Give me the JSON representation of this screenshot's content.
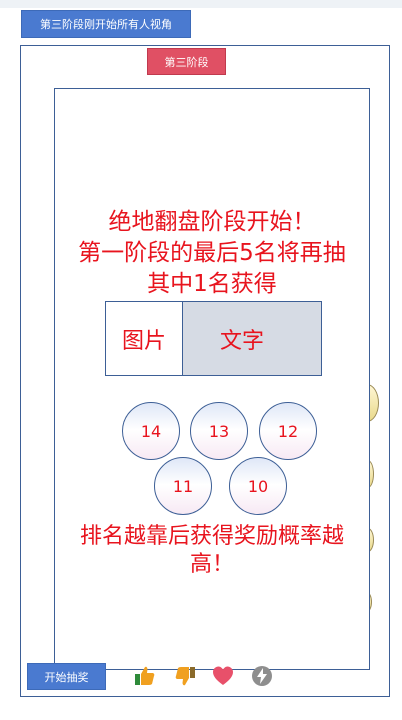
{
  "top_tab": {
    "label": "第三阶段刚开始所有人视角"
  },
  "stage_badge": {
    "label": "第三阶段"
  },
  "modal": {
    "headline": [
      "绝地翻盘阶段开始！",
      "第一阶段的最后5名将再抽",
      "其中1名获得"
    ],
    "media": {
      "image_label": "图片",
      "text_label": "文字"
    },
    "numbers": [
      "14",
      "13",
      "12",
      "11",
      "10"
    ],
    "footer": [
      "排名越靠后获得奖励概率越",
      "高！"
    ]
  },
  "bottom_bar": {
    "start_button": "开始抽奖",
    "icons": [
      "thumbs-up-icon",
      "thumbs-down-icon",
      "heart-icon",
      "lightning-icon"
    ]
  },
  "colors": {
    "accent_blue": "#4a7ad0",
    "badge_red": "#e05064",
    "text_red": "#e8141e"
  }
}
